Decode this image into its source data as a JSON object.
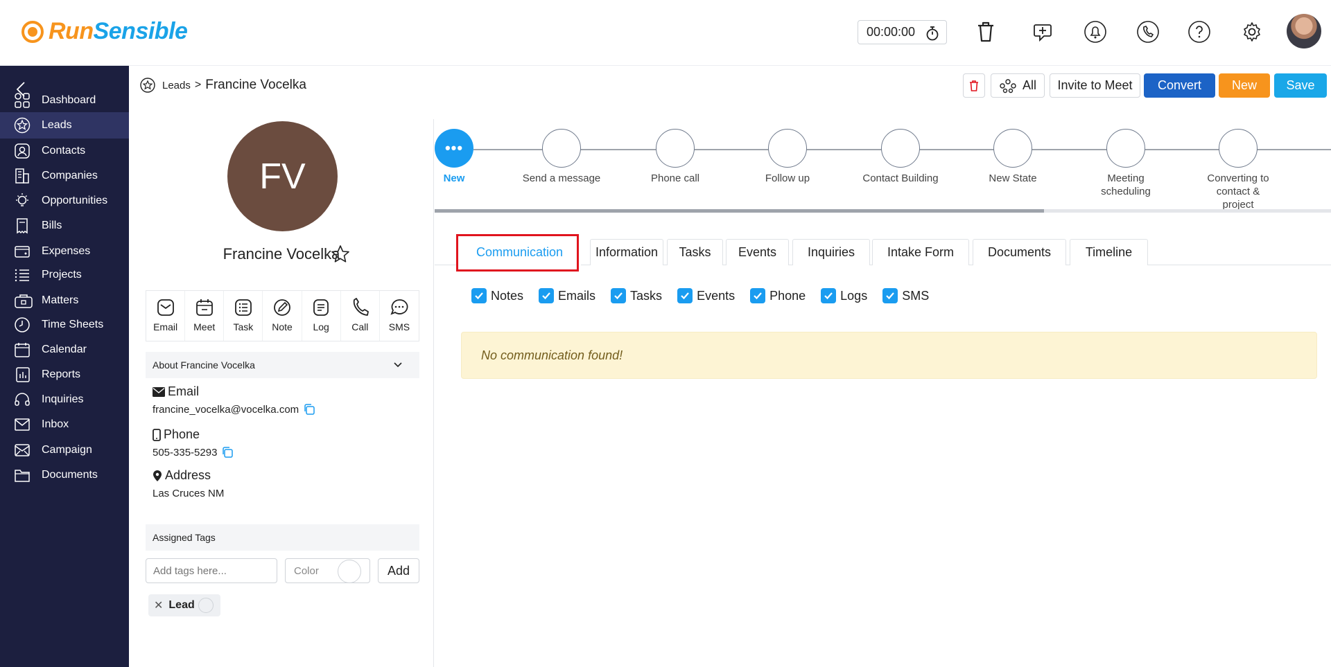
{
  "brand": {
    "name_part1": "Run",
    "name_part2": "Sensible",
    "orange": "#f7941d",
    "blue": "#1aa3e8"
  },
  "topbar": {
    "timer": "00:00:00",
    "icons": [
      "trash-icon",
      "add-reminder-icon",
      "notification-bell-icon",
      "phone-icon",
      "help-icon",
      "settings-gear-icon"
    ]
  },
  "sidebar": {
    "items": [
      {
        "label": "Dashboard",
        "icon": "dashboard-icon"
      },
      {
        "label": "Leads",
        "icon": "star-icon",
        "active": true
      },
      {
        "label": "Contacts",
        "icon": "contact-icon"
      },
      {
        "label": "Companies",
        "icon": "building-icon"
      },
      {
        "label": "Opportunities",
        "icon": "lightbulb-icon"
      },
      {
        "label": "Bills",
        "icon": "bill-icon"
      },
      {
        "label": "Expenses",
        "icon": "wallet-icon"
      },
      {
        "label": "Projects",
        "icon": "list-icon"
      },
      {
        "label": "Matters",
        "icon": "briefcase-icon"
      },
      {
        "label": "Time Sheets",
        "icon": "clock-icon"
      },
      {
        "label": "Calendar",
        "icon": "calendar-icon"
      },
      {
        "label": "Reports",
        "icon": "report-icon"
      },
      {
        "label": "Inquiries",
        "icon": "headset-icon"
      },
      {
        "label": "Inbox",
        "icon": "inbox-icon"
      },
      {
        "label": "Campaign",
        "icon": "campaign-icon"
      },
      {
        "label": "Documents",
        "icon": "folder-icon"
      }
    ]
  },
  "breadcrumb": {
    "section": "Leads",
    "current": "Francine Vocelka"
  },
  "toolbar": {
    "all_label": "All",
    "invite_label": "Invite to Meet",
    "convert_label": "Convert",
    "new_label": "New",
    "save_label": "Save"
  },
  "lead": {
    "initials": "FV",
    "name": "Francine Vocelka",
    "avatar_color": "#6b4c3f",
    "about_title": "About Francine Vocelka",
    "email_label": "Email",
    "email": "francine_vocelka@vocelka.com",
    "phone_label": "Phone",
    "phone": "505-335-5293",
    "address_label": "Address",
    "address": "Las Cruces NM"
  },
  "actions": [
    "Email",
    "Meet",
    "Task",
    "Note",
    "Log",
    "Call",
    "SMS"
  ],
  "tags": {
    "header": "Assigned Tags",
    "input_placeholder": "Add tags here...",
    "color_label": "Color",
    "add_label": "Add",
    "items": [
      "Lead"
    ]
  },
  "stages": {
    "current_index": 0,
    "progress_fraction": 0.68,
    "items": [
      "New",
      "Send a message",
      "Phone call",
      "Follow up",
      "Contact Building",
      "New State",
      "Meeting scheduling",
      "Converting to contact & project"
    ]
  },
  "tabs": {
    "active_index": 0,
    "items": [
      "Communication",
      "Information",
      "Tasks",
      "Events",
      "Inquiries",
      "Intake Form",
      "Documents",
      "Timeline"
    ]
  },
  "filters": [
    "Notes",
    "Emails",
    "Tasks",
    "Events",
    "Phone",
    "Logs",
    "SMS"
  ],
  "empty_message": "No communication found!"
}
